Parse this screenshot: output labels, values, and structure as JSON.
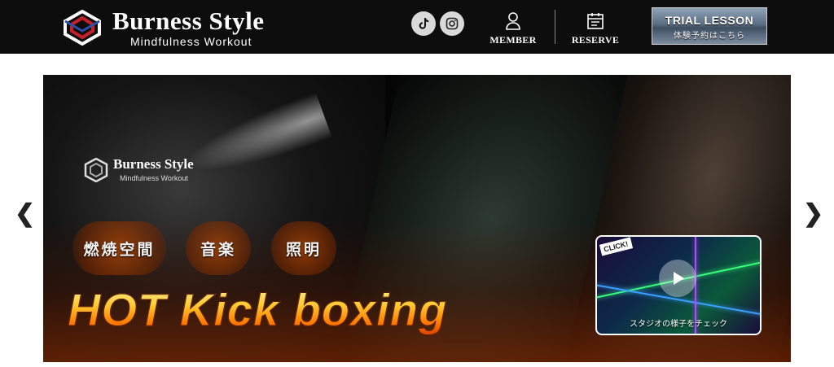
{
  "header": {
    "logo_title": "Burness Style",
    "logo_subtitle": "Mindfulness  Workout",
    "social": [
      {
        "name": "tiktok-icon"
      },
      {
        "name": "instagram-icon"
      }
    ],
    "nav": {
      "member_label": "MEMBER",
      "reserve_label": "RESERVE"
    },
    "trial": {
      "title": "TRIAL LESSON",
      "subtitle": "体験予約はこちら"
    }
  },
  "carousel": {
    "prev_arrow": "❮",
    "next_arrow": "❯",
    "banner": {
      "inner_logo_title": "Burness Style",
      "inner_logo_subtitle": "Mindfulness Workout",
      "badges": [
        "燃焼空間",
        "音楽",
        "照明"
      ],
      "headline": "HOT Kick boxing",
      "video": {
        "click_tag": "CLICK!",
        "caption": "スタジオの様子をチェック"
      }
    }
  },
  "colors": {
    "header_bg": "#0d0d0d",
    "headline_gold": "#ffcc33",
    "headline_orange": "#ff7a00"
  }
}
